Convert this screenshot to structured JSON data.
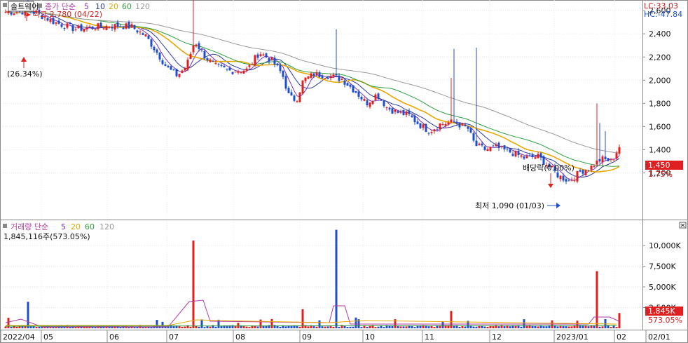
{
  "price_panel": {
    "stock_name": "솔트웨어",
    "legend_label": "종가 단순",
    "legend_periods": [
      "5",
      "10",
      "20",
      "60",
      "120"
    ],
    "lc_text": "LC:33.03",
    "hc_text": "HC:-47.84",
    "high_marker": "최고 2,780 (04/22)",
    "low_marker": "최저 1,090 (01/03)",
    "change_marker": "(26.34%)",
    "dividend_marker": "배당락(0.00%)",
    "current_price_badge": "1,450",
    "current_change": "1.75%"
  },
  "volume_panel": {
    "legend_label": "거래량 단순",
    "legend_periods": [
      "5",
      "20",
      "60",
      "120"
    ],
    "volume_text": "1,845,116주(573.05%)",
    "current_volume_badge": "1,845K",
    "current_ratio": "573.05%"
  },
  "chart_data": [
    {
      "type": "candlestick",
      "yaxis": {
        "ticks": [
          1200,
          1400,
          1600,
          1800,
          2000,
          2200,
          2400,
          2600
        ],
        "tick_labels": [
          "1,200",
          "1,400",
          "1,600",
          "1,800",
          "2,000",
          "2,200",
          "2,400",
          "2,600"
        ],
        "ylim": [
          1000,
          2820
        ]
      },
      "xaxis": {
        "labels": [
          "2022/04",
          "05",
          "06",
          "07",
          "08",
          "09",
          "10",
          "11",
          "12",
          "2023/01",
          "02",
          "02/01"
        ]
      },
      "series": [
        {
          "name": "5",
          "color": "#7b2fbe"
        },
        {
          "name": "10",
          "color": "#2a3a9e"
        },
        {
          "name": "20",
          "color": "#e6a800"
        },
        {
          "name": "60",
          "color": "#2e9e3e"
        },
        {
          "name": "120",
          "color": "#9a9a9a"
        }
      ],
      "annotations": [
        {
          "text": "최고 2,780 (04/22)",
          "value": 2780
        },
        {
          "text": "최저 1,090 (01/03)",
          "value": 1090
        },
        {
          "text": "배당락(0.00%)"
        },
        {
          "text": "(26.34%)"
        }
      ],
      "last_close": 1450,
      "grid": true
    },
    {
      "type": "bar",
      "yaxis": {
        "ticks": [
          2500,
          5000,
          7500,
          10000
        ],
        "tick_labels": [
          "2,500K",
          "5,000K",
          "7,500K",
          "10,000K"
        ],
        "unit": "K"
      },
      "spikes_k": [
        3200,
        10600,
        11900,
        3200,
        2300,
        2100,
        6900,
        1845
      ],
      "last_volume": "1,845K",
      "grid": true
    }
  ],
  "colors": {
    "up": "#e02020",
    "down": "#1f4fc8",
    "badge": "#e02020",
    "frame": "#8a8a8a"
  }
}
